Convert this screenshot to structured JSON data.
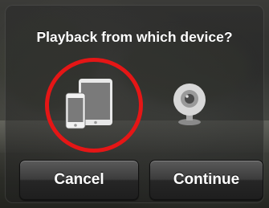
{
  "dialog": {
    "title": "Playback from which device?",
    "options": [
      {
        "icon": "iphone-ipad-icon",
        "selected": true
      },
      {
        "icon": "webcam-icon",
        "selected": false
      }
    ],
    "buttons": {
      "cancel_label": "Cancel",
      "continue_label": "Continue"
    }
  },
  "colors": {
    "highlight_ring": "#e51616",
    "text": "#ffffff"
  }
}
